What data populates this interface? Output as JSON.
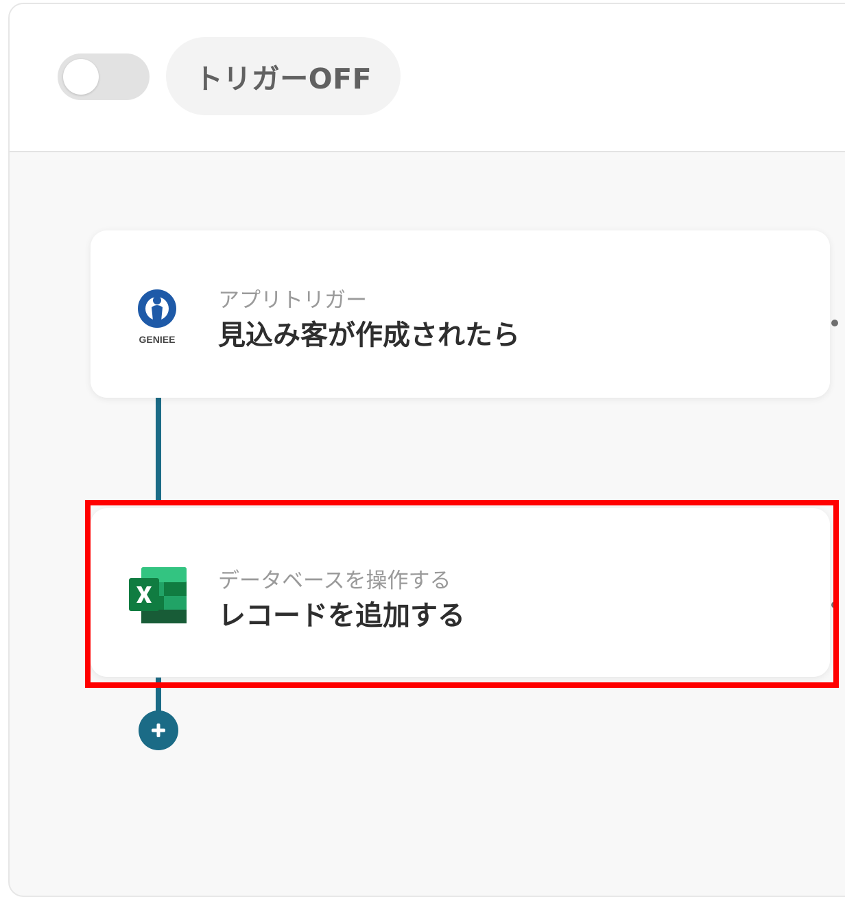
{
  "toolbar": {
    "trigger_toggle_state": "off",
    "trigger_status_label": "トリガーOFF"
  },
  "flow": {
    "steps": [
      {
        "app_icon": "geniee-logo-icon",
        "app_logo_text": "GENIEE",
        "subtitle": "アプリトリガー",
        "title": "見込み客が作成されたら"
      },
      {
        "app_icon": "excel-icon",
        "subtitle": "データベースを操作する",
        "title": "レコードを追加する",
        "highlighted": true
      }
    ],
    "add_step_icon": "plus-icon"
  },
  "colors": {
    "connector": "#1b6b86",
    "highlight_border": "#ff0000",
    "geniee_blue": "#1e5aa8",
    "excel_green": "#1d7044"
  }
}
